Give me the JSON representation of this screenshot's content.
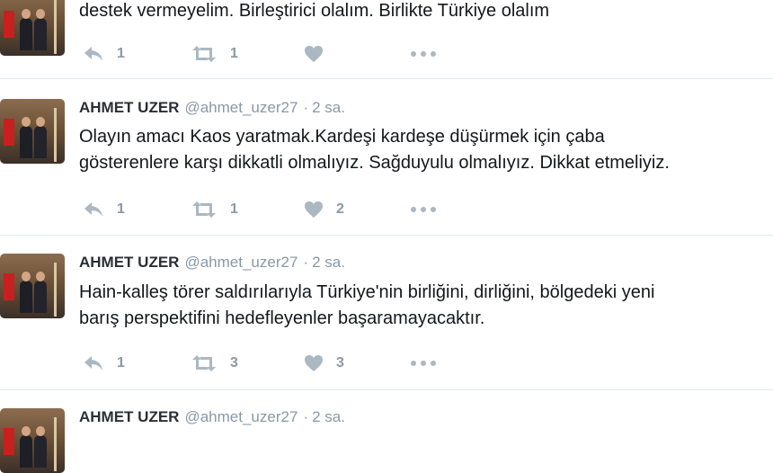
{
  "tweets": [
    {
      "text_lines": [
        "destek vermeyelim. Birleştirici olalım. Birlikte Türkiye olalım"
      ],
      "reply_count": "1",
      "retweet_count": "1",
      "like_count": ""
    },
    {
      "name": "AHMET UZER",
      "handle": "@ahmet_uzer27",
      "dot": "·",
      "time": "2 sa.",
      "text_lines": [
        "Olayın amacı Kaos yaratmak.Kardeşi kardeşe düşürmek için çaba",
        "gösterenlere karşı dikkatli olmalıyız. Sağduyulu olmalıyız. Dikkat etmeliyiz."
      ],
      "reply_count": "1",
      "retweet_count": "1",
      "like_count": "2"
    },
    {
      "name": "AHMET UZER",
      "handle": "@ahmet_uzer27",
      "dot": "·",
      "time": "2 sa.",
      "text_lines": [
        "Hain-kalleş törer saldırılarıyla Türkiye'nin birliğini, dirliğini, bölgedeki yeni",
        "barış perspektifini hedefleyenler başaramayacaktır."
      ],
      "reply_count": "1",
      "retweet_count": "3",
      "like_count": "3"
    },
    {
      "name": "AHMET UZER",
      "handle": "@ahmet_uzer27",
      "dot": "·",
      "time": "2 sa."
    }
  ],
  "icons": {
    "reply": "reply-icon",
    "retweet": "retweet-icon",
    "like": "heart-icon",
    "more": "more-dots-icon"
  },
  "colors": {
    "icon_gray": "#aab8c2",
    "count_gray": "#8899a6",
    "divider": "#e1e8ed",
    "text": "#14171a"
  }
}
